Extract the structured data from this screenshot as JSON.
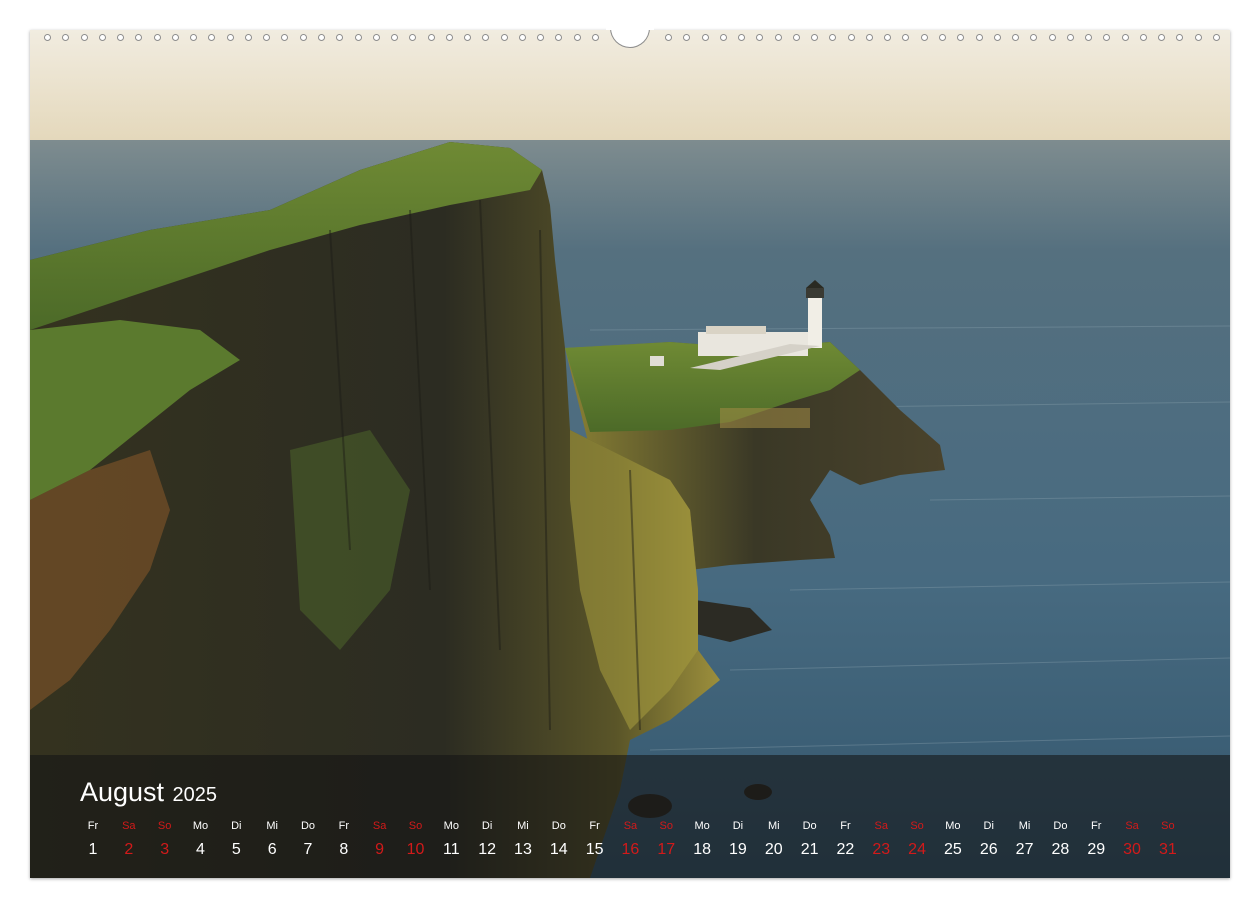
{
  "calendar": {
    "month": "August",
    "year": "2025",
    "weekend_color": "#d21a1a",
    "days": [
      {
        "wd": "Fr",
        "n": "1",
        "we": false
      },
      {
        "wd": "Sa",
        "n": "2",
        "we": true
      },
      {
        "wd": "So",
        "n": "3",
        "we": true
      },
      {
        "wd": "Mo",
        "n": "4",
        "we": false
      },
      {
        "wd": "Di",
        "n": "5",
        "we": false
      },
      {
        "wd": "Mi",
        "n": "6",
        "we": false
      },
      {
        "wd": "Do",
        "n": "7",
        "we": false
      },
      {
        "wd": "Fr",
        "n": "8",
        "we": false
      },
      {
        "wd": "Sa",
        "n": "9",
        "we": true
      },
      {
        "wd": "So",
        "n": "10",
        "we": true
      },
      {
        "wd": "Mo",
        "n": "11",
        "we": false
      },
      {
        "wd": "Di",
        "n": "12",
        "we": false
      },
      {
        "wd": "Mi",
        "n": "13",
        "we": false
      },
      {
        "wd": "Do",
        "n": "14",
        "we": false
      },
      {
        "wd": "Fr",
        "n": "15",
        "we": false
      },
      {
        "wd": "Sa",
        "n": "16",
        "we": true
      },
      {
        "wd": "So",
        "n": "17",
        "we": true
      },
      {
        "wd": "Mo",
        "n": "18",
        "we": false
      },
      {
        "wd": "Di",
        "n": "19",
        "we": false
      },
      {
        "wd": "Mi",
        "n": "20",
        "we": false
      },
      {
        "wd": "Do",
        "n": "21",
        "we": false
      },
      {
        "wd": "Fr",
        "n": "22",
        "we": false
      },
      {
        "wd": "Sa",
        "n": "23",
        "we": true
      },
      {
        "wd": "So",
        "n": "24",
        "we": true
      },
      {
        "wd": "Mo",
        "n": "25",
        "we": false
      },
      {
        "wd": "Di",
        "n": "26",
        "we": false
      },
      {
        "wd": "Mi",
        "n": "27",
        "we": false
      },
      {
        "wd": "Do",
        "n": "28",
        "we": false
      },
      {
        "wd": "Fr",
        "n": "29",
        "we": false
      },
      {
        "wd": "Sa",
        "n": "30",
        "we": true
      },
      {
        "wd": "So",
        "n": "31",
        "we": true
      }
    ]
  },
  "photo": {
    "subject": "sea-cliff-lighthouse-image",
    "colors": {
      "sky_top": "#f3eee0",
      "sky_horizon": "#e7dcc0",
      "sea_far": "#5d7684",
      "sea_near": "#3d5d72",
      "cliff_dark": "#2d2c22",
      "cliff_lit": "#8f8a3c",
      "grass": "#5d7a2e"
    }
  }
}
